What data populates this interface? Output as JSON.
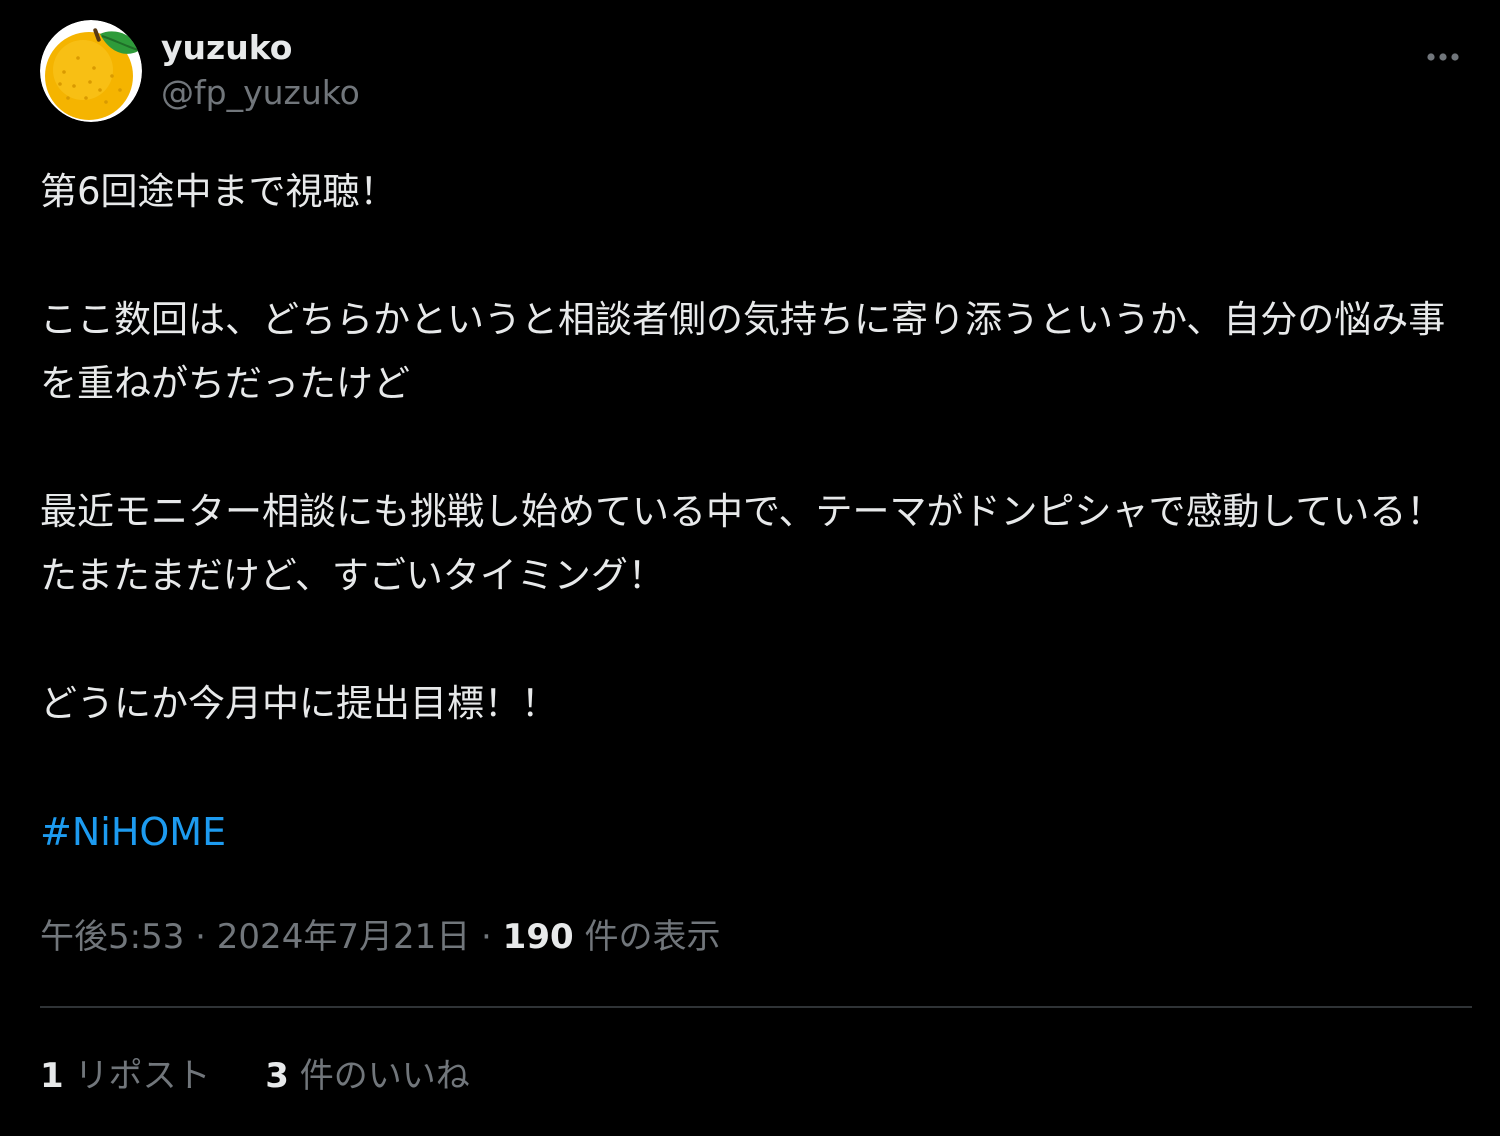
{
  "user": {
    "display_name": "yuzuko",
    "handle": "@fp_yuzuko",
    "avatar_icon": "yuzu-fruit-avatar-icon"
  },
  "more_icon": "more-options-icon",
  "tweet": {
    "paragraphs": [
      "第6回途中まで視聴！",
      "ここ数回は、どちらかというと相談者側の気持ちに寄り添うというか、自分の悩み事を重ねがちだったけど",
      "最近モニター相談にも挑戦し始めている中で、テーマがドンピシャで感動している！たまたまだけど、すごいタイミング！",
      "どうにか今月中に提出目標！！"
    ],
    "hashtag": "#NiHOME"
  },
  "meta": {
    "time": "午後5:53",
    "separator": " · ",
    "date": "2024年7月21日",
    "views_count": "190",
    "views_label": " 件の表示"
  },
  "stats": {
    "reposts_count": "1",
    "reposts_label": " リポスト",
    "likes_count": "3",
    "likes_label": " 件のいいね"
  },
  "colors": {
    "background": "#000000",
    "text": "#e7e9ea",
    "secondary": "#71767b",
    "link": "#1d9bf0",
    "divider": "#2f3336"
  }
}
